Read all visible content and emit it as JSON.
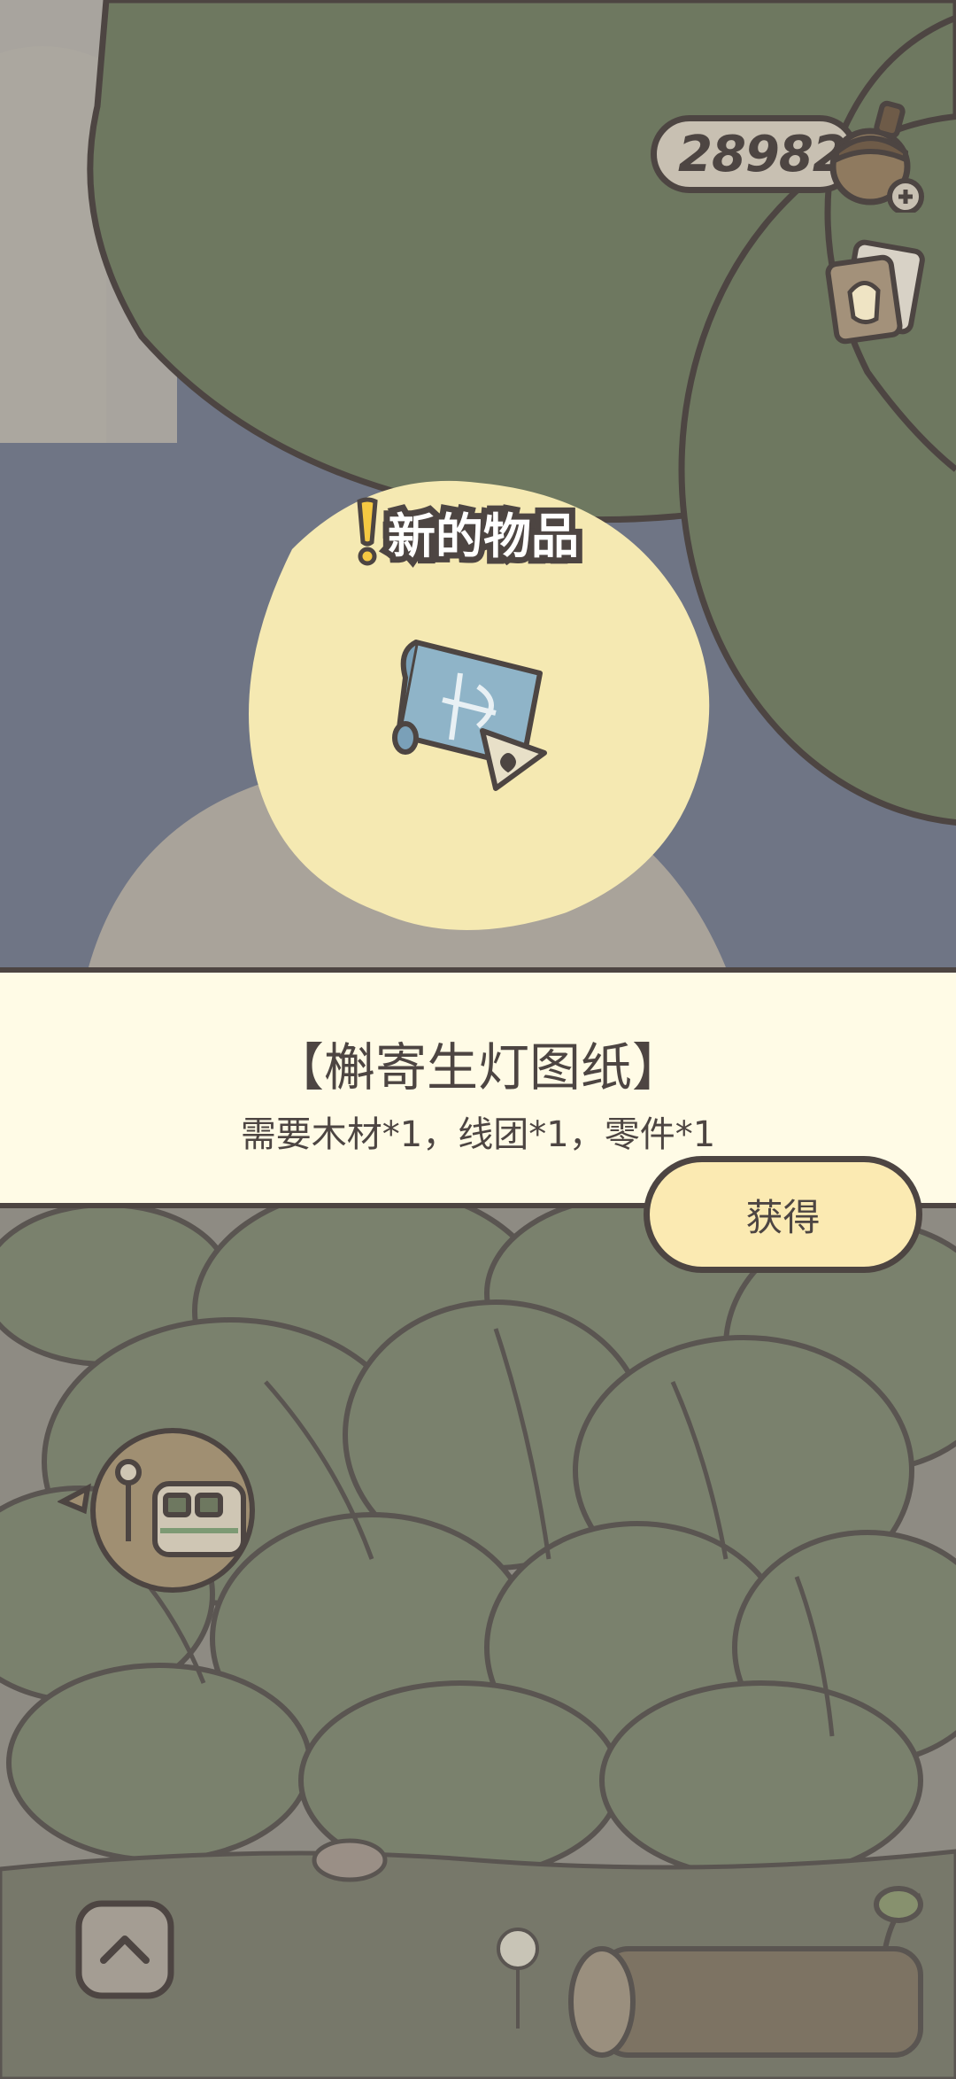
{
  "hud": {
    "acorn_count": "289828",
    "acorn_icon": "acorn-icon",
    "add_icon": "plus-icon",
    "cards_icon": "cards-icon"
  },
  "new_item": {
    "badge": "新的物品",
    "icon": "blueprint-icon"
  },
  "item_panel": {
    "title": "【槲寄生灯图纸】",
    "requirement": "需要木材*1，线团*1，零件*1",
    "get_button": "获得"
  },
  "scene": {
    "bus_icon": "bus-stop-icon",
    "up_icon": "chevron-up-icon"
  },
  "colors": {
    "outline": "#4d4542",
    "panel_bg": "#fffbe6",
    "button_bg": "#fbeab2",
    "spotlight": "#f5e9b2",
    "leaf_green": "#6e7860",
    "sky": "#6f7585"
  }
}
